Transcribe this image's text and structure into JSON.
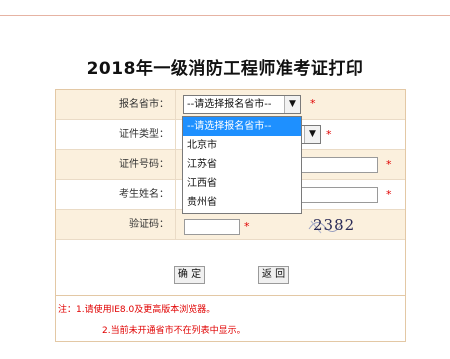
{
  "page": {
    "title": "2018年一级消防工程师准考证打印"
  },
  "form": {
    "province": {
      "label": "报名省市：",
      "value": "--请选择报名省市--"
    },
    "id_type": {
      "label": "证件类型："
    },
    "id_number": {
      "label": "证件号码："
    },
    "name": {
      "label": "考生姓名："
    },
    "captcha": {
      "label": "验证码：",
      "image_text": "2382"
    },
    "required_mark": "*"
  },
  "dropdown": {
    "options": [
      "--请选择报名省市--",
      "北京市",
      "江苏省",
      "江西省",
      "贵州省"
    ],
    "selected_index": 0
  },
  "buttons": {
    "confirm": "确 定",
    "back": "返 回"
  },
  "notes": {
    "line1": "注：1.请使用IE8.0及更高版本浏览器。",
    "line2": "2.当前未开通省市不在列表中显示。"
  },
  "colors": {
    "accent_red": "#e00000",
    "row_shade": "#fbf0dd",
    "highlight": "#1e90ff"
  },
  "icons": {
    "select_arrow": "chevron-down-icon"
  }
}
